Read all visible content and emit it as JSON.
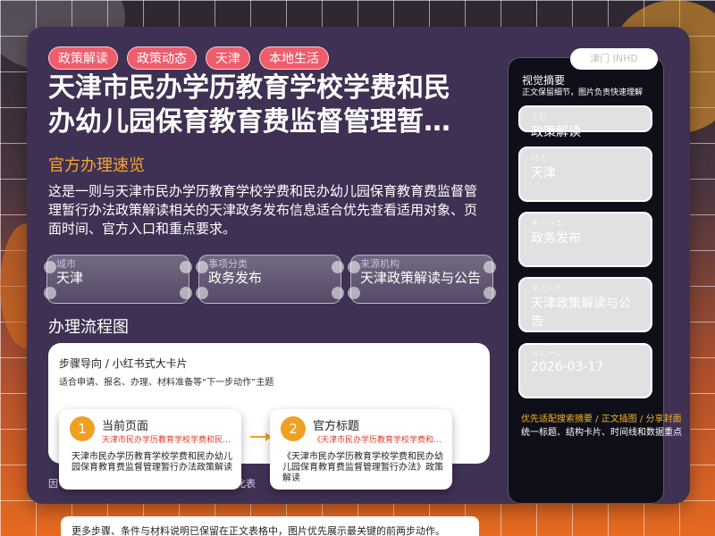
{
  "tags": [
    "政策解读",
    "政策动态",
    "天津",
    "本地生活"
  ],
  "title": "天津市民办学历教育学校学费和民办幼儿园保育教育费监督管理暂行办法",
  "subtitle": "官方办理速览",
  "summary": "这是一则与天津市民办学历教育学校学费和民办幼儿园保育教育费监督管理暂行办法政策解读相关的天津政务发布信息适合优先查看适用对象、页面时间、官方入口和重点要求。",
  "info": [
    {
      "label": "城市",
      "value": "天津"
    },
    {
      "label": "事项分类",
      "value": "政务发布"
    },
    {
      "label": "来源机构",
      "value": "天津政策解读与公告"
    }
  ],
  "flow": {
    "section_title": "办理流程图",
    "head": "步骤导向 / 小红书式大卡片",
    "desc": "适合申请、报名、办理、材料准备等“下一步动作”主题",
    "steps": [
      {
        "num": "1",
        "name": "当前页面",
        "sub": "天津市民办学历教育学校学费和民办幼儿园保育教育费",
        "body": "天津市民办学历教育学校学费和民办幼儿园保育教育费监督管理暂行办法政策解读"
      },
      {
        "num": "2",
        "name": "官方标题",
        "sub": "《天津市民办学历教育学校学费和民办幼儿园保育教育费",
        "body": "《天津市民办学历教育学校学费和民办幼儿园保育教育费监督管理暂行办法》政策解读"
      }
    ]
  },
  "footnote": {
    "start": "因",
    "tail": "化表"
  },
  "bottom_note": "更多步骤、条件与材料说明已保留在正文表格中，图片优先展示最关键的前两步动作。",
  "side": {
    "pill": "津门 INHD",
    "title": "视觉摘要",
    "subtitle": "正文保留细节，图片负责快速理解",
    "items": [
      {
        "label": "主题",
        "value": "政策解读"
      },
      {
        "label": "城市",
        "value": "天津"
      },
      {
        "label": "事项分类",
        "value": "政务发布"
      },
      {
        "label": "来源机构",
        "value": "天津政策解读与公告"
      },
      {
        "label": "发布时间",
        "value": "2026-03-17"
      }
    ],
    "foot1": "优先适配搜索摘要 / 正文插图 / 分享封面",
    "foot2": "统一标题、结构卡片、时间线和数据重点"
  }
}
